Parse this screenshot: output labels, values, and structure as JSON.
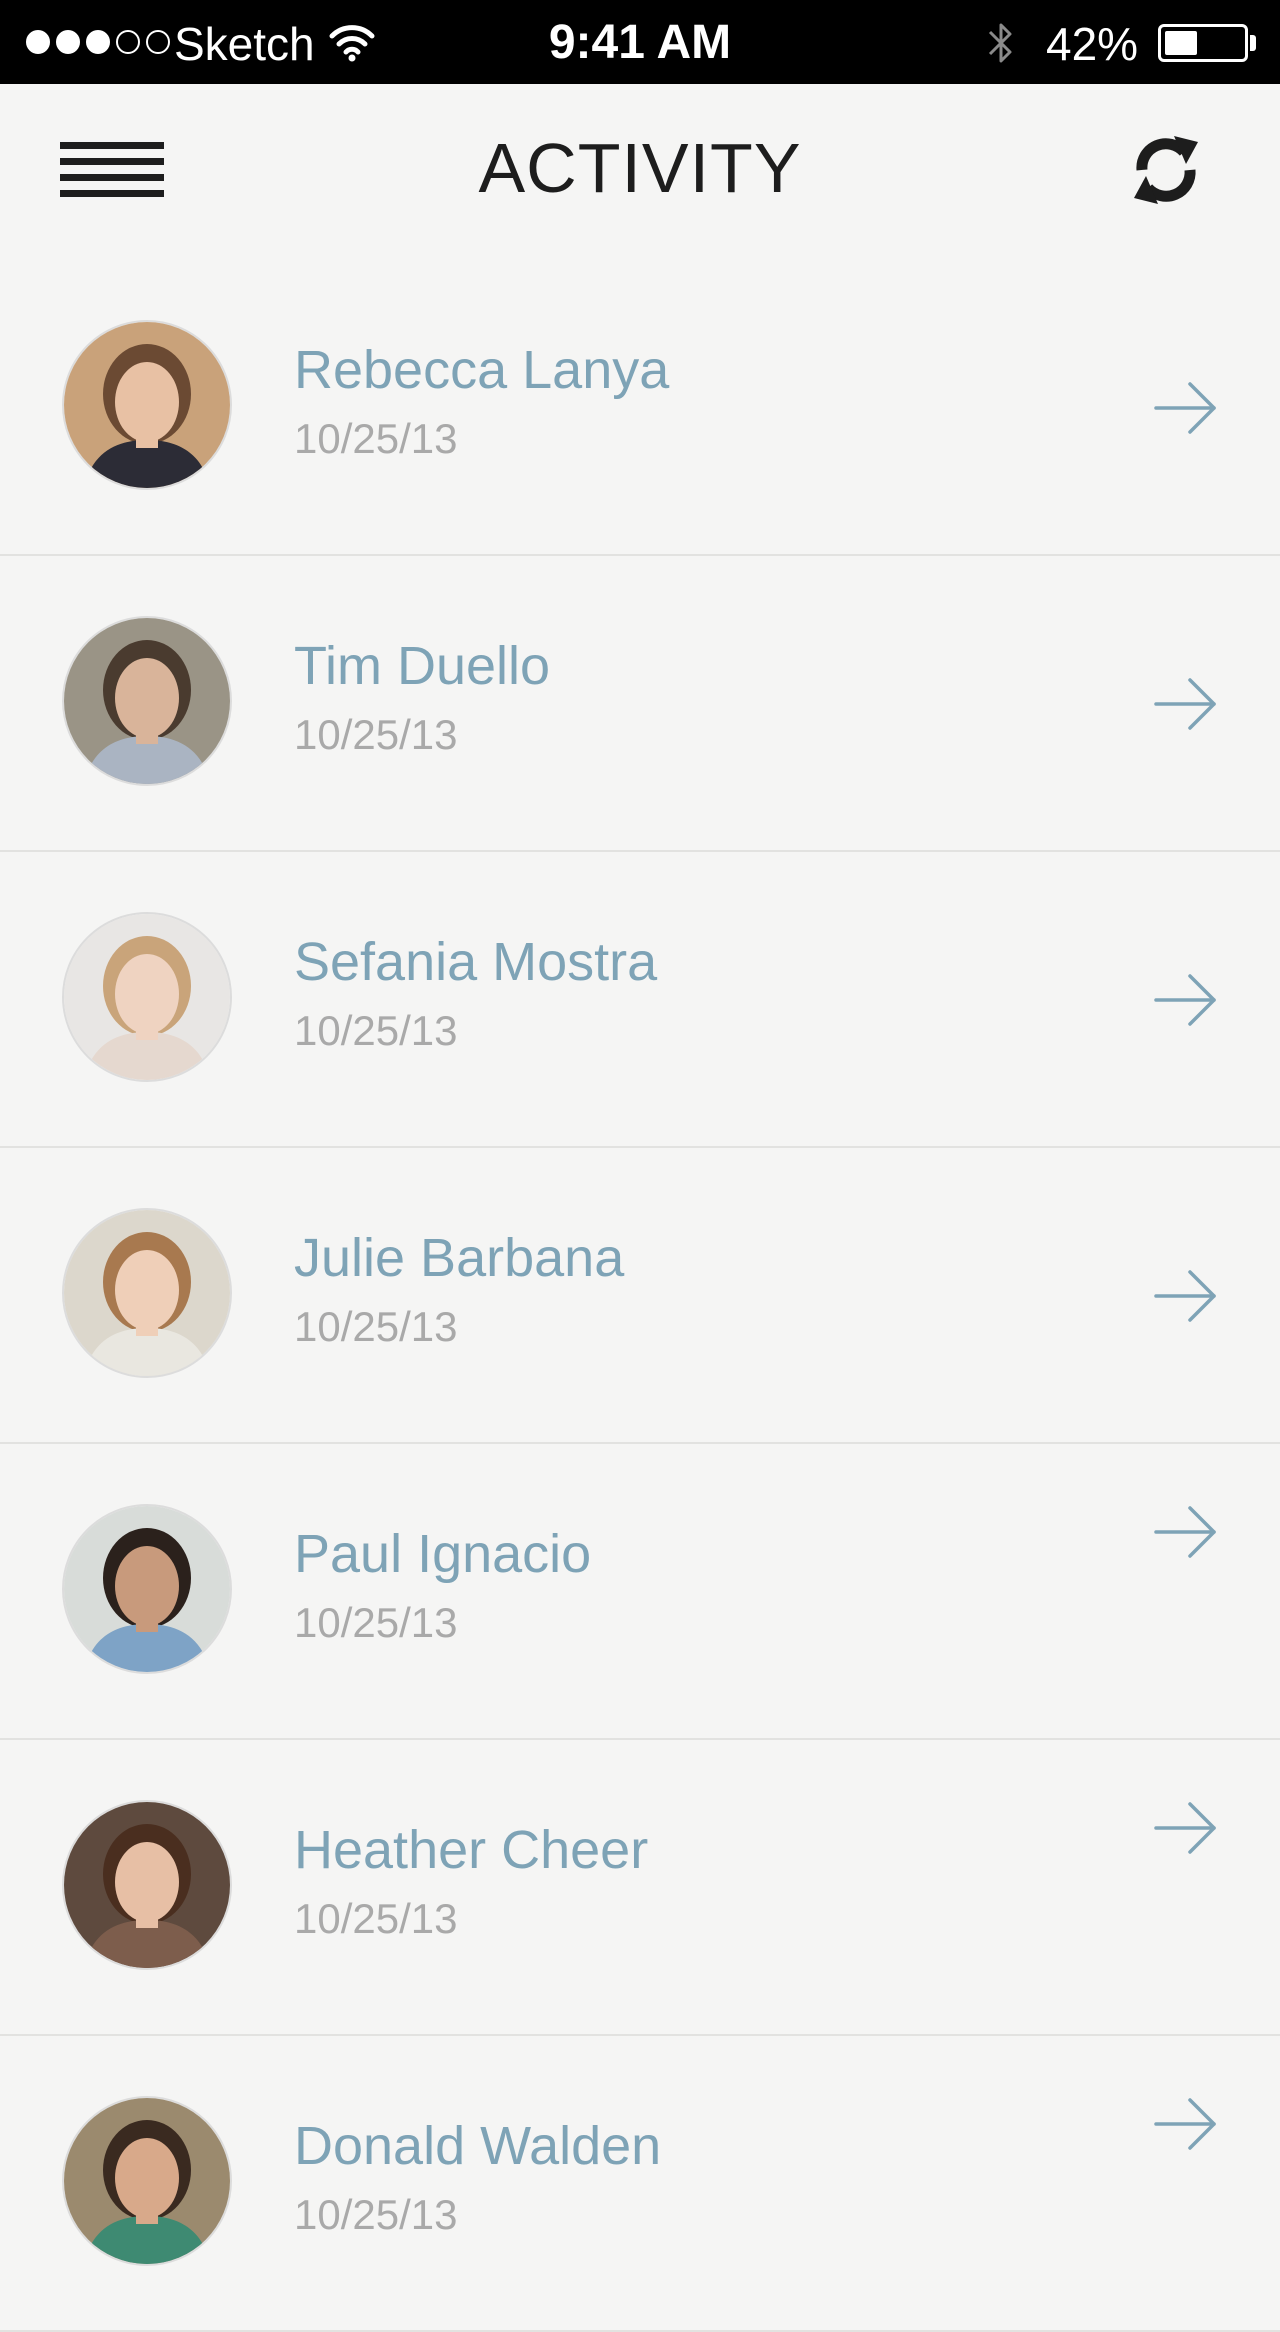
{
  "status_bar": {
    "carrier": "Sketch",
    "time": "9:41 AM",
    "battery_text": "42%",
    "battery_level": 0.42,
    "signal_bars_filled": 3,
    "signal_bars_total": 5,
    "icons": [
      "signal-dots-icon",
      "wifi-icon",
      "bluetooth-icon",
      "battery-icon"
    ]
  },
  "header": {
    "title": "ACTIVITY",
    "menu_icon": "hamburger-menu-icon",
    "refresh_icon": "refresh-icon"
  },
  "colors": {
    "name_text": "#7ea3b6",
    "date_text": "#a9a9a9",
    "arrow": "#7ea3b6",
    "background": "#f5f5f4",
    "divider": "#e2e2e0",
    "title_text": "#1d1d1d"
  },
  "activity": {
    "items": [
      {
        "name": "Rebecca Lanya",
        "date": "10/25/13"
      },
      {
        "name": "Tim Duello",
        "date": "10/25/13"
      },
      {
        "name": "Sefania Mostra",
        "date": "10/25/13"
      },
      {
        "name": "Julie Barbana",
        "date": "10/25/13"
      },
      {
        "name": "Paul Ignacio",
        "date": "10/25/13"
      },
      {
        "name": "Heather Cheer",
        "date": "10/25/13"
      },
      {
        "name": "Donald Walden",
        "date": "10/25/13"
      }
    ]
  }
}
